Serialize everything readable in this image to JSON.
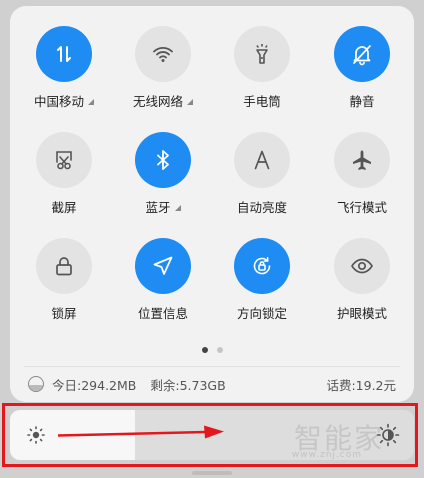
{
  "colors": {
    "active": "#1e8cf2",
    "inactive": "#e3e3e3",
    "annotation": "#e3181d"
  },
  "tiles": [
    {
      "label": "中国移动",
      "icon": "mobile-data-icon",
      "active": true,
      "corner": true
    },
    {
      "label": "无线网络",
      "icon": "wifi-icon",
      "active": false,
      "corner": true
    },
    {
      "label": "手电筒",
      "icon": "flashlight-icon",
      "active": false,
      "corner": false
    },
    {
      "label": "静音",
      "icon": "mute-bell-icon",
      "active": true,
      "corner": false
    },
    {
      "label": "截屏",
      "icon": "screenshot-icon",
      "active": false,
      "corner": false
    },
    {
      "label": "蓝牙",
      "icon": "bluetooth-icon",
      "active": true,
      "corner": true
    },
    {
      "label": "自动亮度",
      "icon": "auto-brightness-icon",
      "active": false,
      "corner": false
    },
    {
      "label": "飞行模式",
      "icon": "airplane-icon",
      "active": false,
      "corner": false
    },
    {
      "label": "锁屏",
      "icon": "lock-icon",
      "active": false,
      "corner": false
    },
    {
      "label": "位置信息",
      "icon": "location-icon",
      "active": true,
      "corner": false
    },
    {
      "label": "方向锁定",
      "icon": "rotation-lock-icon",
      "active": true,
      "corner": false
    },
    {
      "label": "护眼模式",
      "icon": "eye-icon",
      "active": false,
      "corner": false
    }
  ],
  "pager": {
    "current": 1,
    "total": 2
  },
  "stats": {
    "today": "今日:294.2MB",
    "remaining": "剩余:5.73GB",
    "fee": "话费:19.2元"
  },
  "brightness": {
    "level": 0.31
  },
  "watermark": {
    "main": "智能家",
    "sub": "www.znj.com"
  }
}
